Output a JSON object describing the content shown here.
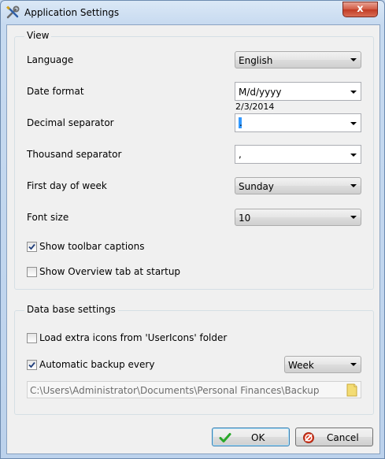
{
  "window": {
    "title": "Application Settings",
    "close_glyph": "x",
    "icon": "wrench-screwdriver-icon"
  },
  "view": {
    "group_title": "View",
    "language": {
      "label": "Language",
      "value": "English"
    },
    "date_format": {
      "label": "Date format",
      "value": "M/d/yyyy",
      "sample": "2/3/2014"
    },
    "decimal_separator": {
      "label": "Decimal separator",
      "value": "."
    },
    "thousand_separator": {
      "label": "Thousand separator",
      "value": ","
    },
    "first_day": {
      "label": "First day of week",
      "value": "Sunday"
    },
    "font_size": {
      "label": "Font size",
      "value": "10"
    },
    "show_toolbar_captions": {
      "label": "Show toolbar captions",
      "checked": true
    },
    "show_overview_tab": {
      "label": "Show Overview tab at startup",
      "checked": false
    }
  },
  "database": {
    "group_title": "Data base settings",
    "load_extra_icons": {
      "label": "Load extra icons from 'UserIcons' folder",
      "checked": false
    },
    "automatic_backup": {
      "label": "Automatic backup every",
      "checked": true,
      "interval": "Week"
    },
    "backup_path": "C:\\Users\\Administrator\\Documents\\Personal Finances\\Backup"
  },
  "buttons": {
    "ok": "OK",
    "cancel": "Cancel"
  },
  "colors": {
    "ok_check": "#2aa82a",
    "cancel_icon": "#d8371e",
    "folder": "#f3dc74"
  }
}
